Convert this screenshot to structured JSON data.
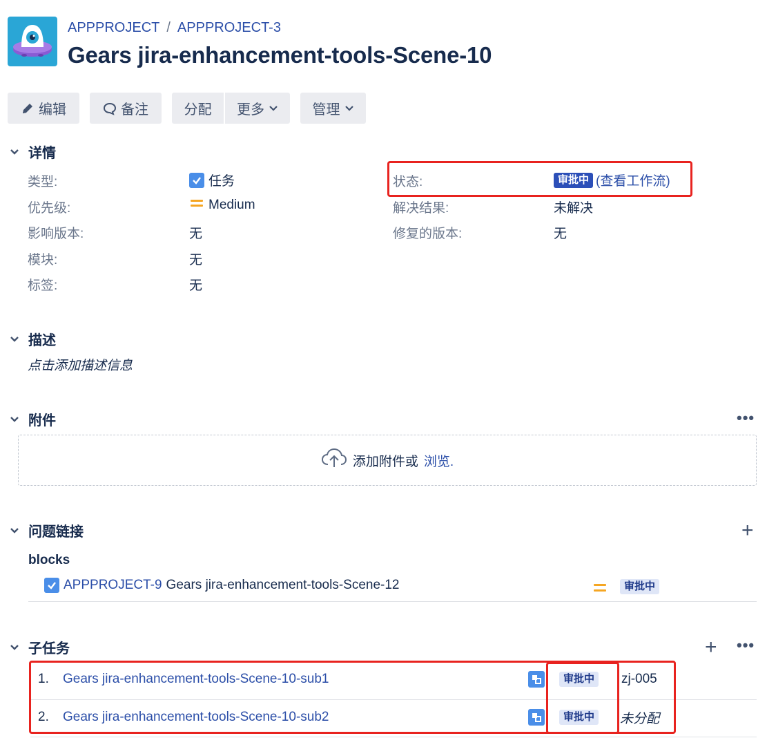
{
  "breadcrumb": {
    "project": "APPPROJECT",
    "separator": "/",
    "issue_key": "APPPROJECT-3"
  },
  "issue": {
    "title": "Gears jira-enhancement-tools-Scene-10"
  },
  "toolbar": {
    "edit": "编辑",
    "comment": "备注",
    "assign": "分配",
    "more": "更多",
    "admin": "管理"
  },
  "details": {
    "header": "详情",
    "type_label": "类型:",
    "type_value": "任务",
    "priority_label": "优先级:",
    "priority_value": "Medium",
    "affects_label": "影响版本:",
    "affects_value": "无",
    "component_label": "模块:",
    "component_value": "无",
    "labels_label": "标签:",
    "labels_value": "无",
    "status_label": "状态:",
    "status_value": "审批中",
    "workflow_link": "查看工作流",
    "workflow_open": "(",
    "workflow_close": ")",
    "resolution_label": "解决结果:",
    "resolution_value": "未解决",
    "fix_label": "修复的版本:",
    "fix_value": "无"
  },
  "description": {
    "header": "描述",
    "placeholder": "点击添加描述信息"
  },
  "attachments": {
    "header": "附件",
    "more": "•••",
    "drop_text": "添加附件或",
    "browse": "浏览."
  },
  "links": {
    "header": "问题链接",
    "add": "+",
    "group": "blocks",
    "items": [
      {
        "key": "APPPROJECT-9",
        "summary": "Gears jira-enhancement-tools-Scene-12",
        "status": "审批中"
      }
    ]
  },
  "subtasks": {
    "header": "子任务",
    "add": "+",
    "more": "•••",
    "items": [
      {
        "num": "1.",
        "summary": "Gears jira-enhancement-tools-Scene-10-sub1",
        "status": "审批中",
        "assignee": "zj-005"
      },
      {
        "num": "2.",
        "summary": "Gears jira-enhancement-tools-Scene-10-sub2",
        "status": "审批中",
        "assignee": "未分配"
      }
    ]
  },
  "colors": {
    "link": "#2b4ea8",
    "lozenge_dark": "#2c4fb8",
    "lozenge_light": "#dfe6f7",
    "highlight": "#e8231f",
    "priority_medium": "#f5a623"
  }
}
